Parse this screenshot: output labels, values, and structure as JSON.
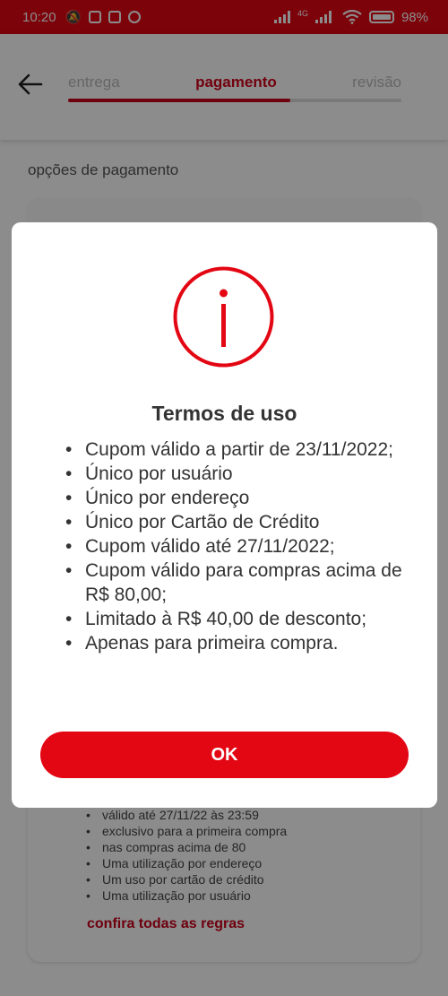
{
  "status_bar": {
    "time": "10:20",
    "network": "4G",
    "battery": "98%"
  },
  "header": {
    "steps": [
      "entrega",
      "pagamento",
      "revisão"
    ],
    "active_step": 1
  },
  "section_title": "opções de pagamento",
  "rules_card": {
    "items": [
      "válido até 27/11/22 às 23:59",
      "exclusivo para a primeira compra",
      "nas compras acima de 80",
      "Uma utilização por endereço",
      "Um uso por cartão de crédito",
      "Uma utilização por usuário"
    ],
    "link": "confira todas as regras"
  },
  "modal": {
    "icon": "info-icon",
    "title": "Termos de uso",
    "terms": [
      "Cupom válido a partir de 23/11/2022;",
      "Único por usuário",
      "Único por endereço",
      "Único por Cartão de Crédito",
      "Cupom válido até 27/11/2022;",
      "Cupom válido para compras acima de R$ 80,00;",
      "Limitado à R$ 40,00 de desconto;",
      "Apenas para primeira compra."
    ],
    "ok_label": "OK"
  },
  "colors": {
    "brand": "#e30613",
    "overlay": "rgba(0,0,0,0.45)"
  }
}
